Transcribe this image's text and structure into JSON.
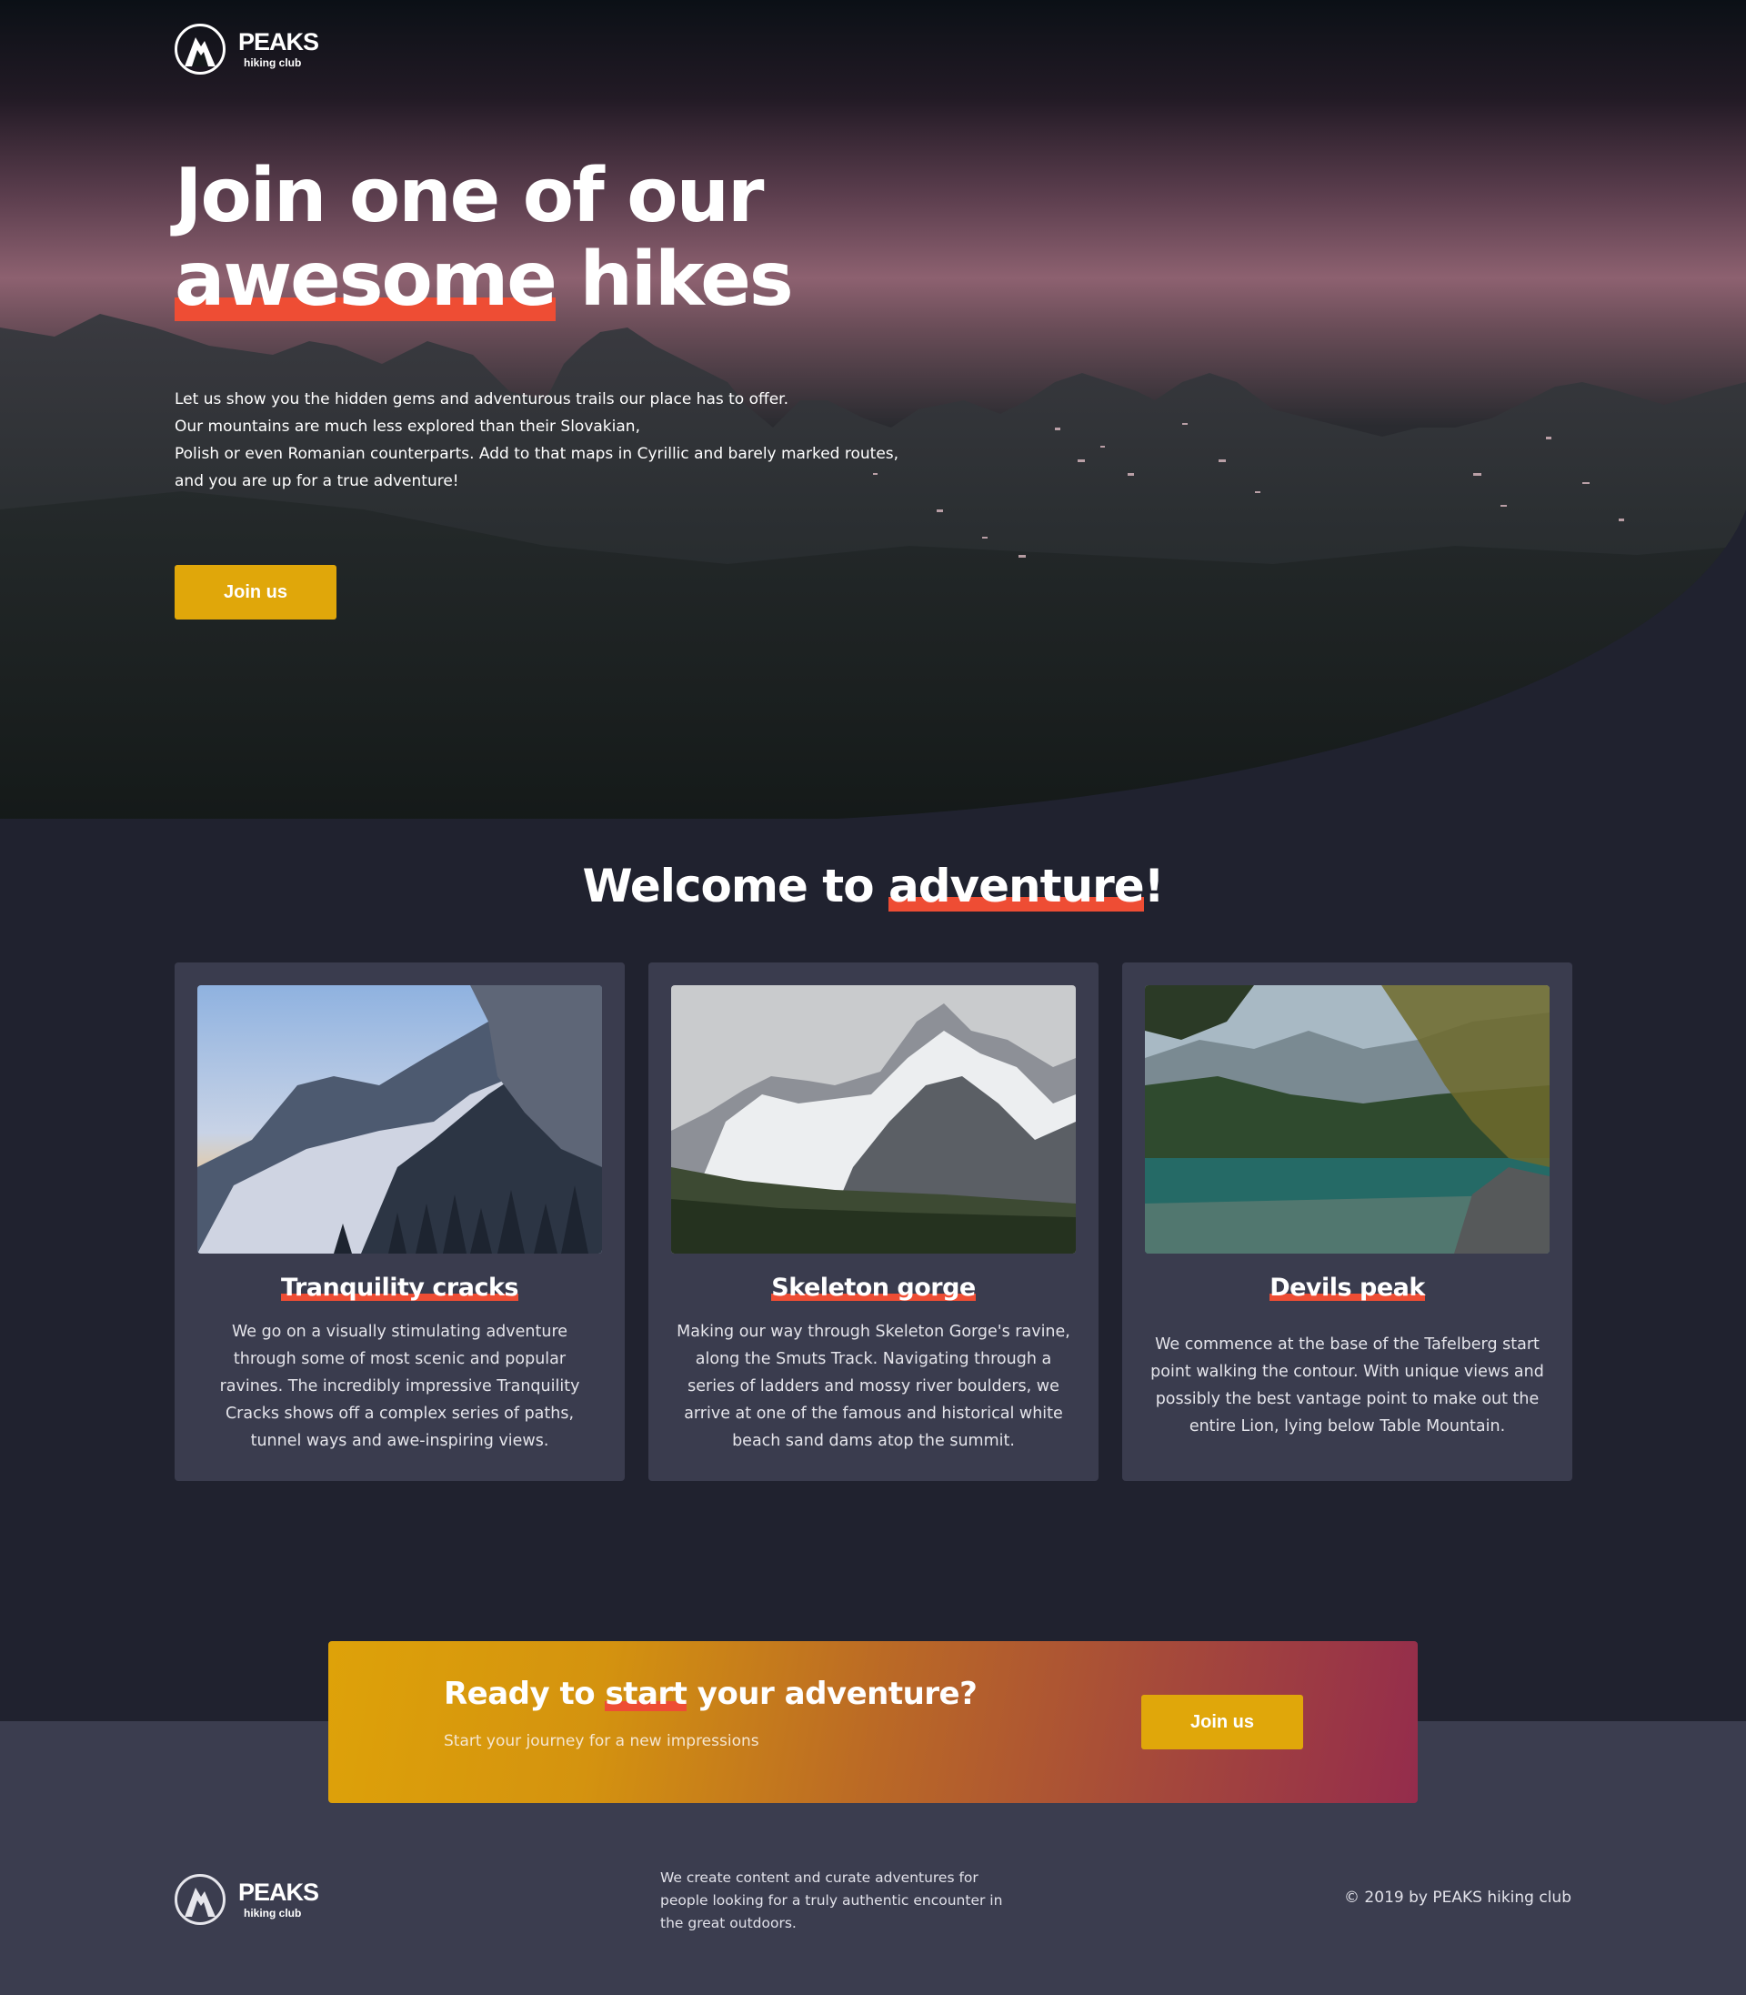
{
  "header": {
    "brand": "PEAKS",
    "brand_sub": "hiking club"
  },
  "hero": {
    "title_line1": "Join one of our",
    "title_highlight": "awesome",
    "title_line2_rest": " hikes",
    "text_lines": [
      "Let us show you the hidden gems and adventurous trails our place has to offer.",
      "Our mountains are much less explored than their Slovakian,",
      "Polish or even Romanian counterparts. Add to that maps in Cyrillic and barely marked routes,",
      "and you are up for a true adventure!"
    ],
    "button_label": "Join us"
  },
  "welcome": {
    "title_prefix": "Welcome to ",
    "title_highlight": "adventure",
    "title_suffix": "!"
  },
  "cards": [
    {
      "title": "Tranquility cracks",
      "text": "We go on a visually stimulating adventure through some of most scenic and popular ravines. The incredibly impressive Tranquility Cracks shows off a complex series of paths, tunnel ways and awe-inspiring views."
    },
    {
      "title": "Skeleton gorge",
      "text": "Making our way through Skeleton Gorge's ravine, along the Smuts Track. Navigating through a series of ladders and mossy river boulders, we arrive at one of the famous and historical white beach sand dams atop the summit."
    },
    {
      "title": "Devils peak",
      "text": "We commence at the base of the Tafelberg start point walking the contour. With unique views and possibly the best vantage point to make out the entire Lion, lying below Table Mountain."
    }
  ],
  "cta": {
    "title_prefix": "Ready to ",
    "title_highlight": "start",
    "title_suffix": " your adventure?",
    "subtitle": "Start your journey for a new impressions",
    "button_label": "Join us"
  },
  "footer": {
    "brand": "PEAKS",
    "brand_sub": "hiking club",
    "description": "We create content and curate adventures for people looking for a truly authentic encounter in the great outdoors.",
    "copyright": "© 2019 by PEAKS hiking club"
  },
  "colors": {
    "accent_highlight": "#ee4d34",
    "button": "#e0a70a",
    "background": "#20222f",
    "card": "#3a3c4e",
    "footer": "#3b3d4f"
  },
  "icons": {
    "logo": "mountain-peak-icon"
  }
}
